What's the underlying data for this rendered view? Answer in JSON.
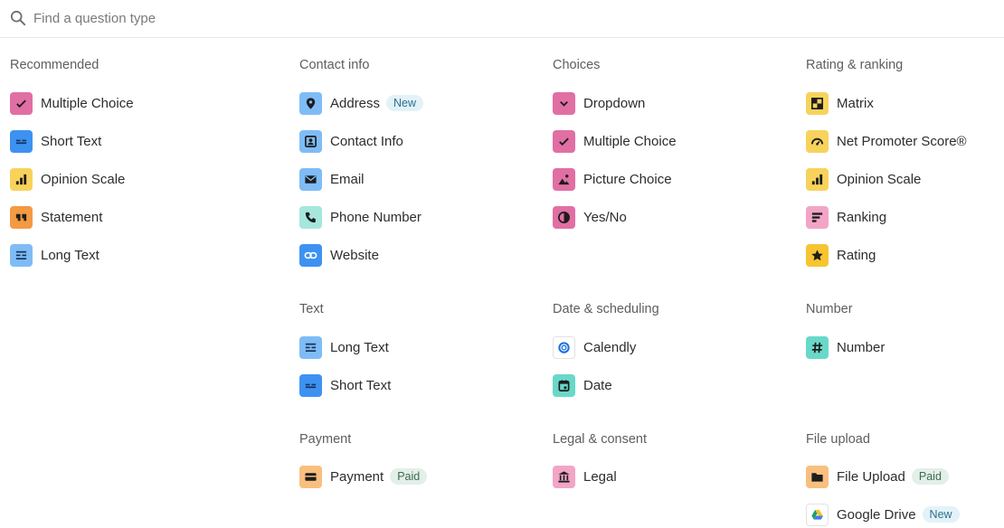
{
  "search": {
    "placeholder": "Find a question type"
  },
  "sections": {
    "recommended": {
      "title": "Recommended",
      "items": [
        "Multiple Choice",
        "Short Text",
        "Opinion Scale",
        "Statement",
        "Long Text"
      ]
    },
    "contact_info": {
      "title": "Contact info",
      "items": [
        "Address",
        "Contact Info",
        "Email",
        "Phone Number",
        "Website"
      ],
      "badge_address": "New"
    },
    "choices": {
      "title": "Choices",
      "items": [
        "Dropdown",
        "Multiple Choice",
        "Picture Choice",
        "Yes/No"
      ]
    },
    "rating_ranking": {
      "title": "Rating & ranking",
      "items": [
        "Matrix",
        "Net Promoter Score®",
        "Opinion Scale",
        "Ranking",
        "Rating"
      ]
    },
    "text": {
      "title": "Text",
      "items": [
        "Long Text",
        "Short Text"
      ]
    },
    "date_scheduling": {
      "title": "Date & scheduling",
      "items": [
        "Calendly",
        "Date"
      ]
    },
    "number": {
      "title": "Number",
      "items": [
        "Number"
      ]
    },
    "payment": {
      "title": "Payment",
      "items": [
        "Payment"
      ],
      "badge_payment": "Paid"
    },
    "legal_consent": {
      "title": "Legal & consent",
      "items": [
        "Legal"
      ]
    },
    "file_upload": {
      "title": "File upload",
      "items": [
        "File Upload",
        "Google Drive"
      ],
      "badge_file_upload": "Paid",
      "badge_google_drive": "New"
    }
  },
  "colors": {
    "pink": "#e16fa4",
    "blue": "#3d92f1",
    "lightblue": "#7fbcf5",
    "yellow": "#f7d35c",
    "orange": "#f39a42",
    "teal": "#69d8c9",
    "mint": "#a6e6dd",
    "pinkLight": "#f2a5c6",
    "peach": "#f9bf7e",
    "yellowDeep": "#f6c531"
  }
}
